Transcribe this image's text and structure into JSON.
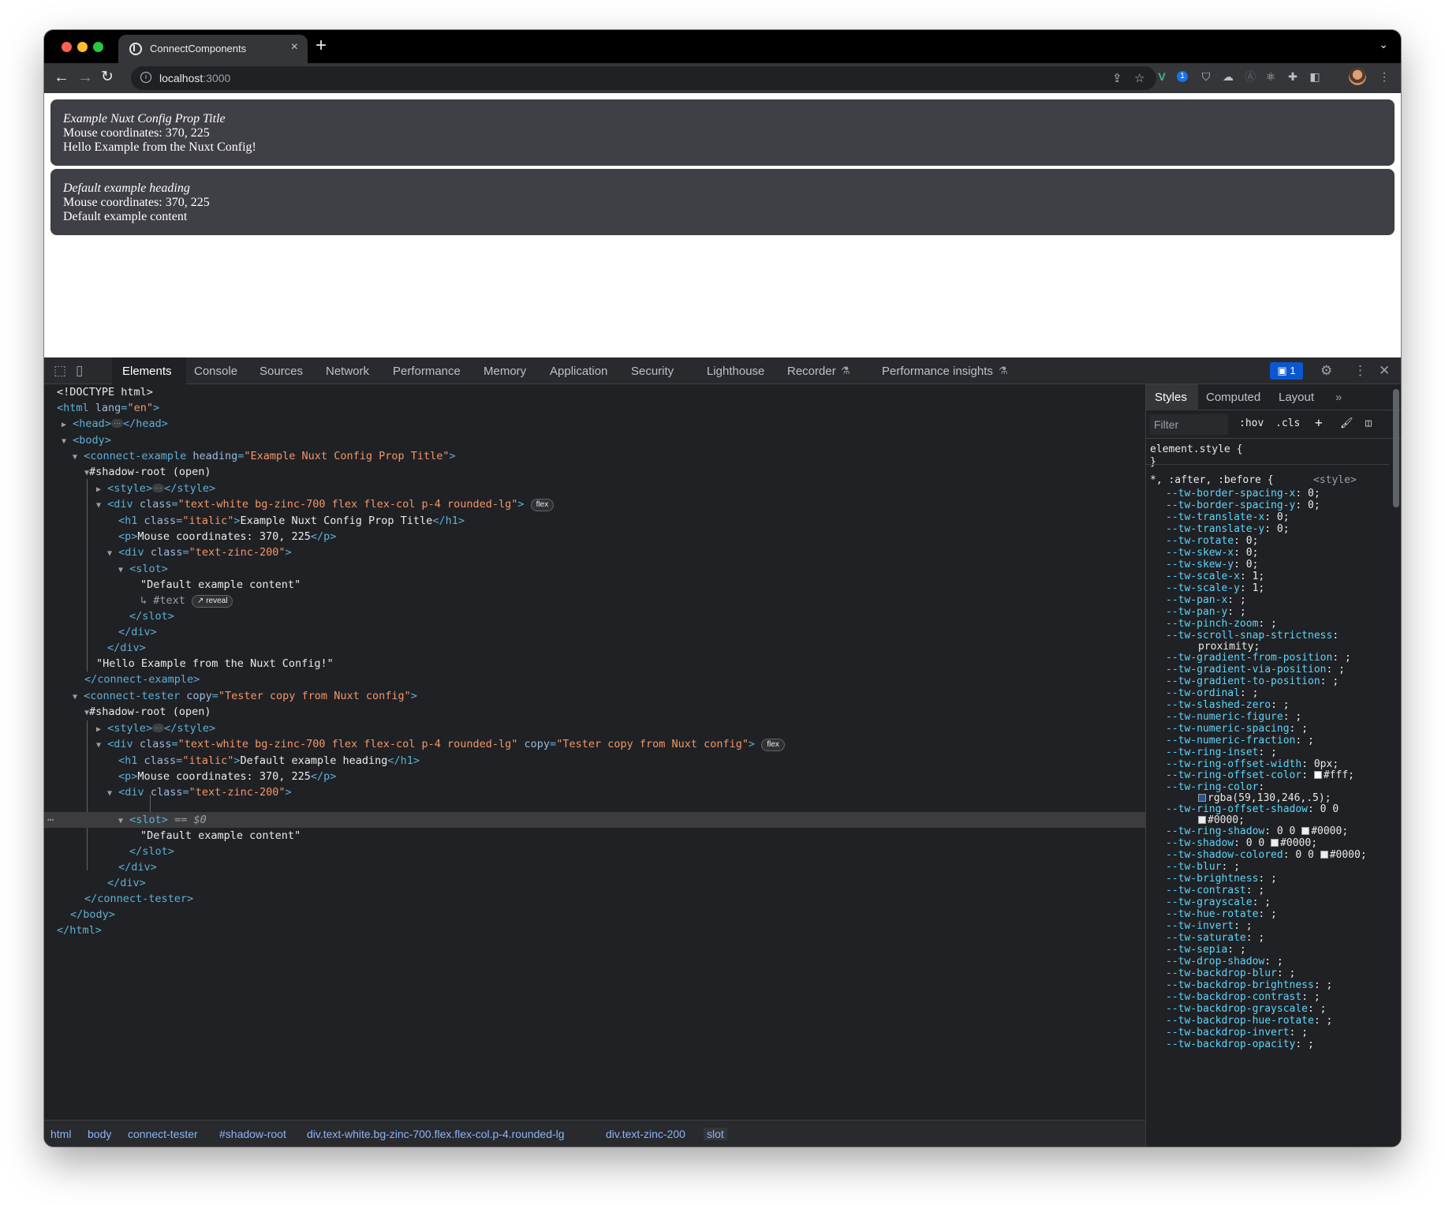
{
  "browser": {
    "tab_title": "ConnectComponents",
    "url_host": "localhost",
    "url_port": ":3000",
    "issues_count": "1"
  },
  "page": {
    "card1": {
      "heading": "Example Nuxt Config Prop Title",
      "coords": "Mouse coordinates: 370, 225",
      "content": "Hello Example from the Nuxt Config!"
    },
    "card2": {
      "heading": "Default example heading",
      "coords": "Mouse coordinates: 370, 225",
      "content": "Default example content"
    }
  },
  "devtools": {
    "tabs": [
      "Elements",
      "Console",
      "Sources",
      "Network",
      "Performance",
      "Memory",
      "Application",
      "Security",
      "Lighthouse",
      "Recorder",
      "Performance insights"
    ],
    "styles_tabs": [
      "Styles",
      "Computed",
      "Layout"
    ],
    "filter_placeholder": "Filter",
    "hov": ":hov",
    "cls": ".cls",
    "breadcrumbs": [
      "html",
      "body",
      "connect-tester",
      "#shadow-root",
      "div.text-white.bg-zinc-700.flex.flex-col.p-4.rounded-lg",
      "div.text-zinc-200",
      "slot"
    ],
    "dom": {
      "doctype": "<!DOCTYPE html>",
      "html_open_tag": "<html",
      "lang_attr": "lang",
      "lang_val": "\"en\"",
      "head": "<head>",
      "head_close": "</head>",
      "body": "<body>",
      "ce1_tag": "<connect-example",
      "ce1_attr": "heading",
      "ce1_val": "\"Example Nuxt Config Prop Title\"",
      "shadow": "#shadow-root (open)",
      "style_open": "<style>",
      "style_close": "</style>",
      "div_tag": "<div",
      "class_attr": "class",
      "div_class": "\"text-white bg-zinc-700 flex flex-col p-4 rounded-lg\"",
      "flex_badge": "flex",
      "h1_tag": "<h1",
      "h1_class": "\"italic\"",
      "h1_text1": "Example Nuxt Config Prop Title",
      "h1_close": "</h1>",
      "p_tag": "<p>",
      "p_text": "Mouse coordinates: 370, 225",
      "p_close": "</p>",
      "div2_class": "\"text-zinc-200\"",
      "slot_tag": "<slot>",
      "slot_text": "\"Default example content\"",
      "text_ref": "↳ #text",
      "reveal": "reveal",
      "slot_close": "</slot>",
      "div_close": "</div>",
      "hello_text": "\"Hello Example from the Nuxt Config!\"",
      "ce1_close": "</connect-example>",
      "ce2_tag": "<connect-tester",
      "ce2_attr": "copy",
      "ce2_val": "\"Tester copy from Nuxt config\"",
      "h1_text2": "Default example heading",
      "slot_marker": "== $0",
      "ce2_close": "</connect-tester>",
      "body_close": "</body>",
      "html_close": "</html>"
    },
    "css": {
      "element_style": "element.style {",
      "rule_selector": "*, :after, :before",
      "rule_source": "<style>",
      "props": [
        [
          "--tw-border-spacing-x",
          "0;"
        ],
        [
          "--tw-border-spacing-y",
          "0;"
        ],
        [
          "--tw-translate-x",
          "0;"
        ],
        [
          "--tw-translate-y",
          "0;"
        ],
        [
          "--tw-rotate",
          "0;"
        ],
        [
          "--tw-skew-x",
          "0;"
        ],
        [
          "--tw-skew-y",
          "0;"
        ],
        [
          "--tw-scale-x",
          "1;"
        ],
        [
          "--tw-scale-y",
          "1;"
        ],
        [
          "--tw-pan-x",
          ";"
        ],
        [
          "--tw-pan-y",
          ";"
        ],
        [
          "--tw-pinch-zoom",
          ";"
        ]
      ],
      "props2": [
        [
          "--tw-gradient-from-position",
          ";"
        ],
        [
          "--tw-gradient-via-position",
          ";"
        ],
        [
          "--tw-gradient-to-position",
          ";"
        ],
        [
          "--tw-ordinal",
          ";"
        ],
        [
          "--tw-slashed-zero",
          ";"
        ],
        [
          "--tw-numeric-figure",
          ";"
        ],
        [
          "--tw-numeric-spacing",
          ";"
        ],
        [
          "--tw-numeric-fraction",
          ";"
        ],
        [
          "--tw-ring-inset",
          ";"
        ],
        [
          "--tw-ring-offset-width",
          "0px;"
        ]
      ],
      "props3": [
        [
          "--tw-blur",
          ";"
        ],
        [
          "--tw-brightness",
          ";"
        ],
        [
          "--tw-contrast",
          ";"
        ],
        [
          "--tw-grayscale",
          ";"
        ],
        [
          "--tw-hue-rotate",
          ";"
        ],
        [
          "--tw-invert",
          ";"
        ],
        [
          "--tw-saturate",
          ";"
        ],
        [
          "--tw-sepia",
          ";"
        ],
        [
          "--tw-drop-shadow",
          ";"
        ],
        [
          "--tw-backdrop-blur",
          ";"
        ],
        [
          "--tw-backdrop-brightness",
          ";"
        ],
        [
          "--tw-backdrop-contrast",
          ";"
        ],
        [
          "--tw-backdrop-grayscale",
          ";"
        ],
        [
          "--tw-backdrop-hue-rotate",
          ";"
        ],
        [
          "--tw-backdrop-invert",
          ";"
        ],
        [
          "--tw-backdrop-opacity",
          ";"
        ]
      ],
      "scroll_snap_prop": "--tw-scroll-snap-strictness",
      "scroll_snap_val": "proximity;",
      "ring_offset_color_prop": "--tw-ring-offset-color",
      "ring_offset_color_val": "#fff;",
      "ring_color_prop": "--tw-ring-color",
      "ring_color_val": "rgba(59,130,246,.5);",
      "ring_offset_shadow_prop": "--tw-ring-offset-shadow",
      "ring_offset_shadow_val": "0 0",
      "shadow_val_0000": "#0000;",
      "ring_shadow_prop": "--tw-ring-shadow",
      "shadow_prop": "--tw-shadow",
      "shadow_colored_prop": "--tw-shadow-colored",
      "zero_zero": "0 0"
    }
  }
}
